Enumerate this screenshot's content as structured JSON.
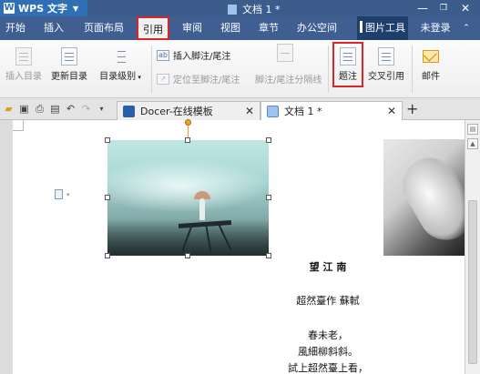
{
  "app": {
    "name": "WPS 文字",
    "document_title": "文档 1 *"
  },
  "menu": {
    "items": [
      "开始",
      "插入",
      "页面布局",
      "引用",
      "审阅",
      "视图",
      "章节",
      "办公空间",
      "图片工具"
    ],
    "active": "引用",
    "login": "未登录"
  },
  "ribbon": {
    "insert_toc": "插入目录",
    "update_toc": "更新目录",
    "toc_level": "目录级别",
    "insert_footnote": "插入脚注/尾注",
    "goto_footnote": "定位至脚注/尾注",
    "footnote_separator": "脚注/尾注分隔线",
    "footnote": "题注",
    "cross_ref": "交叉引用",
    "mail": "邮件"
  },
  "tabs": [
    {
      "label": "Docer-在线模板",
      "active": false
    },
    {
      "label": "文档 1 *",
      "active": true
    }
  ],
  "document": {
    "poem_title": "望 江 南",
    "poem_subtitle": "超然臺作 蘇軾",
    "poem_lines": [
      "春未老，",
      "風細柳斜斜。",
      "試上超然臺上看，"
    ]
  },
  "colors": {
    "menu_bg": "#3f5f93",
    "highlight_red": "#d9262b",
    "title_bg": "#3c5c8c"
  }
}
